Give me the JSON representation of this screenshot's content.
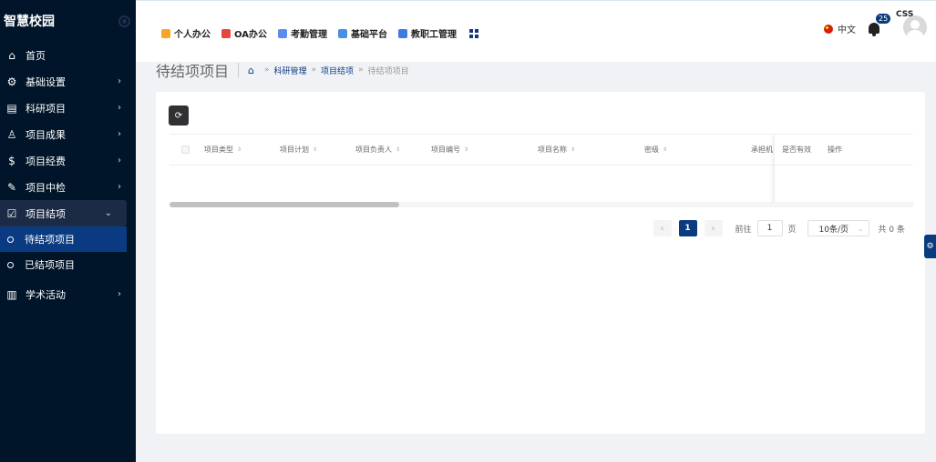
{
  "app": {
    "title": "智慧校园"
  },
  "sidebar": {
    "items": [
      {
        "label": "首页",
        "icon": "home-icon",
        "glyph": "⌂",
        "arrow": ""
      },
      {
        "label": "基础设置",
        "icon": "gear-icon",
        "glyph": "⚙",
        "arrow": "›"
      },
      {
        "label": "科研项目",
        "icon": "document-icon",
        "glyph": "▤",
        "arrow": "›"
      },
      {
        "label": "项目成果",
        "icon": "award-icon",
        "glyph": "♙",
        "arrow": "›"
      },
      {
        "label": "项目经费",
        "icon": "dollar-icon",
        "glyph": "$",
        "arrow": "›"
      },
      {
        "label": "项目中检",
        "icon": "edit-icon",
        "glyph": "✎",
        "arrow": "›"
      },
      {
        "label": "项目结项",
        "icon": "checkbox-icon",
        "glyph": "☑",
        "arrow": "⌄"
      }
    ],
    "subitems": [
      {
        "label": "待结项项目"
      },
      {
        "label": "已结项项目"
      }
    ],
    "last_item": {
      "label": "学术活动",
      "icon": "book-icon",
      "glyph": "▥",
      "arrow": "›"
    }
  },
  "topnav": {
    "items": [
      {
        "label": "个人办公",
        "color": "#f5a623"
      },
      {
        "label": "OA办公",
        "color": "#e8453c"
      },
      {
        "label": "考勤管理",
        "color": "#5b8def"
      },
      {
        "label": "基础平台",
        "color": "#4a90e2"
      },
      {
        "label": "教职工管理",
        "color": "#3d7be0"
      }
    ]
  },
  "header": {
    "language": "中文",
    "notification_count": "25",
    "username": "CSS"
  },
  "page": {
    "title": "待结项项目",
    "breadcrumb": [
      "科研管理",
      "项目结项",
      "待结项项目"
    ],
    "breadcrumb_sep": "»"
  },
  "table": {
    "columns": [
      {
        "label": "项目类型",
        "sortable": true
      },
      {
        "label": "项目计划",
        "sortable": true
      },
      {
        "label": "项目负责人",
        "sortable": true
      },
      {
        "label": "项目编号",
        "sortable": true
      },
      {
        "label": "项目名称",
        "sortable": true
      },
      {
        "label": "密级",
        "sortable": true
      },
      {
        "label": "承担机",
        "sortable": false
      }
    ],
    "fixed_columns": [
      "是否有效",
      "操作"
    ],
    "rows": []
  },
  "pagination": {
    "prev": "‹",
    "next": "›",
    "current_page": "1",
    "goto_label": "前往",
    "goto_value": "1",
    "page_unit": "页",
    "page_size": "10条/页",
    "total": "共 0 条"
  },
  "colors": {
    "sidebar_bg": "#001529",
    "accent": "#0a3b80"
  }
}
